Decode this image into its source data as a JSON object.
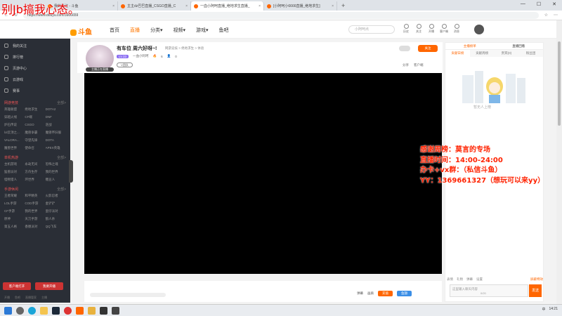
{
  "overlay_title": "别Jb搞我心态。",
  "browser": {
    "tabs": [
      {
        "label": "我的关注 - 斗鱼",
        "active": false
      },
      {
        "label": "主主dz巴巴直播_CSGO直播_C",
        "active": false
      },
      {
        "label": "一血小阿呵直播_绝地求生直播_",
        "active": true
      },
      {
        "label": "[小阿呵小6666直播_绝地求生]",
        "active": false
      }
    ],
    "url": "https://www.douyu.com/3906659",
    "new_tab": "+"
  },
  "header": {
    "logo": "斗鱼",
    "nav": [
      "首页",
      "直播",
      "分类▾",
      "视频▾",
      "游戏▾",
      "鱼吧"
    ],
    "nav_active": 1,
    "search_placeholder": "小阿呵点",
    "icons": [
      "历史",
      "关注",
      "开播",
      "客户端",
      "消息"
    ]
  },
  "sidebar": {
    "main": [
      "我的关注",
      "排行榜",
      "页游中心",
      "云游戏",
      "赛事"
    ],
    "sections": [
      {
        "title": "网游竞技",
        "more": "全部>",
        "items": [
          "英雄联盟",
          "绝地求生",
          "DOTA2",
          "穿越火线",
          "CF端",
          "DNF",
          "炉石传说",
          "CSGO",
          "逆战",
          "lol云顶之...",
          "魔兽争霸",
          "魔兽怀旧服",
          "VALORA...",
          "守望先锋",
          "DOTA",
          "魔兽世界",
          "使命召",
          "APEX英雄"
        ]
      },
      {
        "title": "单机热游",
        "more": "全部>",
        "items": [
          "主机游戏",
          "永劫无间",
          "恐怖之魂",
          "猛兽派对",
          "方舟生存",
          "我的世界",
          "怪物猎人",
          "环世界",
          "糖豆人"
        ]
      },
      {
        "title": "手游休闲",
        "more": "全部>",
        "items": [
          "王者荣耀",
          "和平精英",
          "火影忍者",
          "LOL手游",
          "COD手游",
          "金铲铲",
          "CF手游",
          "我的世界",
          "蛋仔派对",
          "原神",
          "天刀手游",
          "狼人杀",
          "第五人格",
          "香肠派对",
          "QQ飞车"
        ]
      }
    ],
    "buttons": [
      "客户端打开",
      "我要开播"
    ],
    "footer": [
      "开播",
      "鱼吧",
      "直播管家",
      "主播"
    ]
  },
  "room": {
    "title": "有车位 周六好呀~!",
    "crumb": "网游竞技 > 绝地求生 > 体验",
    "level_badge": "LV.33",
    "streamer": "一血小阿呵",
    "heat": "6",
    "fans": "0",
    "tag": "V团队",
    "avatar_label": "主播正在直播",
    "follow": "关注",
    "tools": [
      "分享",
      "客户端"
    ]
  },
  "player_bar": {
    "controls": [
      "弹幕",
      "画质",
      "充值",
      "鱼翅"
    ]
  },
  "right_panel": {
    "tabs_top": [
      "主播榜单",
      "直播回看"
    ],
    "tabs_sub": [
      "贡献日榜",
      "贡献周榜",
      "贵宾(0)",
      "粉丝团"
    ],
    "empty_label": "暂无人上榜",
    "chat_tools": [
      "表情",
      "礼物",
      "弹幕",
      "设置",
      "屏蔽特效"
    ],
    "input_placeholder": "这里输入聊天内容",
    "send": "发送",
    "chat_hint": "0/20"
  },
  "overlay_lines": [
    "感谢周榜：莫言的专场",
    "直播时间：14:00-24:00",
    "办卡+vx群：（私信斗鱼）",
    "YY：1369661327（想玩可以来yy）"
  ],
  "taskbar": {
    "time": "14:21",
    "lang": "中"
  },
  "colors": {
    "accent": "#ff6600",
    "overlay_red": "#ff2200",
    "sidebar_bg": "#2a2e36"
  }
}
